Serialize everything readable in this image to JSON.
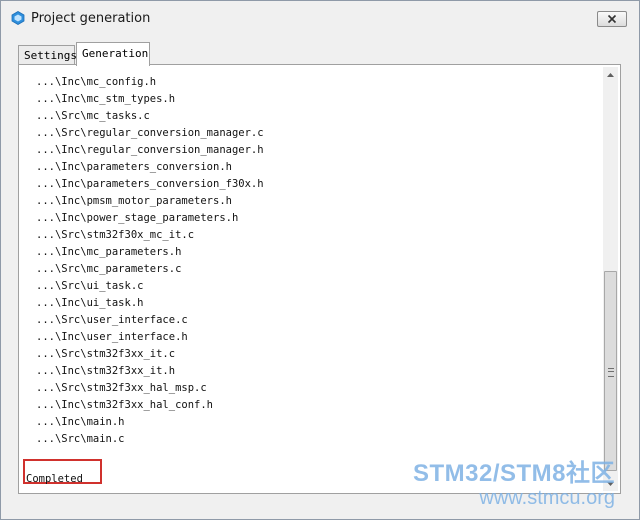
{
  "window": {
    "title": "Project generation",
    "close_glyph": "✕"
  },
  "tabs": [
    {
      "label": "Settings",
      "active": false
    },
    {
      "label": "Generation",
      "active": true
    }
  ],
  "log": {
    "lines": [
      "...\\Inc\\mc_config.h",
      "...\\Inc\\mc_stm_types.h",
      "...\\Src\\mc_tasks.c",
      "...\\Src\\regular_conversion_manager.c",
      "...\\Inc\\regular_conversion_manager.h",
      "...\\Inc\\parameters_conversion.h",
      "...\\Inc\\parameters_conversion_f30x.h",
      "...\\Inc\\pmsm_motor_parameters.h",
      "...\\Inc\\power_stage_parameters.h",
      "...\\Src\\stm32f30x_mc_it.c",
      "...\\Inc\\mc_parameters.h",
      "...\\Src\\mc_parameters.c",
      "...\\Src\\ui_task.c",
      "...\\Inc\\ui_task.h",
      "...\\Src\\user_interface.c",
      "...\\Inc\\user_interface.h",
      "...\\Src\\stm32f3xx_it.c",
      "...\\Inc\\stm32f3xx_it.h",
      "...\\Src\\stm32f3xx_hal_msp.c",
      "...\\Inc\\stm32f3xx_hal_conf.h",
      "...\\Inc\\main.h",
      "...\\Src\\main.c"
    ],
    "status": "Completed"
  },
  "watermark": {
    "line1": "STM32/STM8社区",
    "line2": "www.stmcu.org"
  },
  "colors": {
    "highlight_box": "#d0312d",
    "app_icon": "#2f8fdc",
    "watermark": "#7fb2e5"
  },
  "icons": {
    "app": "app-hexagon-icon",
    "close": "close-icon",
    "scroll_up": "scroll-up-arrow-icon",
    "scroll_down": "scroll-down-arrow-icon"
  }
}
